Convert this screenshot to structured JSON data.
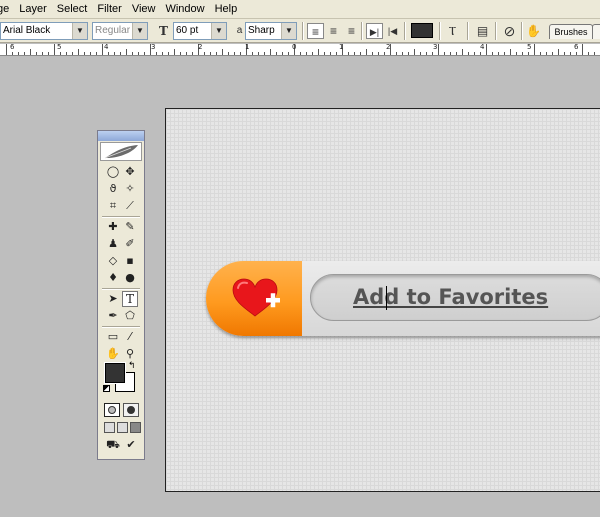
{
  "menubar": {
    "items": [
      "ge",
      "Layer",
      "Select",
      "Filter",
      "View",
      "Window",
      "Help"
    ]
  },
  "options": {
    "font_family": "Arial Black",
    "font_style": "Regular",
    "font_size": "60 pt",
    "antialias_glyph": "a",
    "antialias": "Sharp",
    "text_color": "#333333",
    "brushes_tab": "Brushes"
  },
  "ruler": {
    "labels": [
      "6",
      "5",
      "4",
      "3",
      "2",
      "1",
      "0",
      "1",
      "2",
      "3",
      "4",
      "5",
      "6"
    ]
  },
  "toolbox": {
    "type_tool_glyph": "T",
    "foreground_color": "#333333",
    "background_color": "#ffffff"
  },
  "document": {
    "button_text": "Add to Favorites",
    "accent_color": "#ff9a1f",
    "heart_color": "#e8161b"
  }
}
